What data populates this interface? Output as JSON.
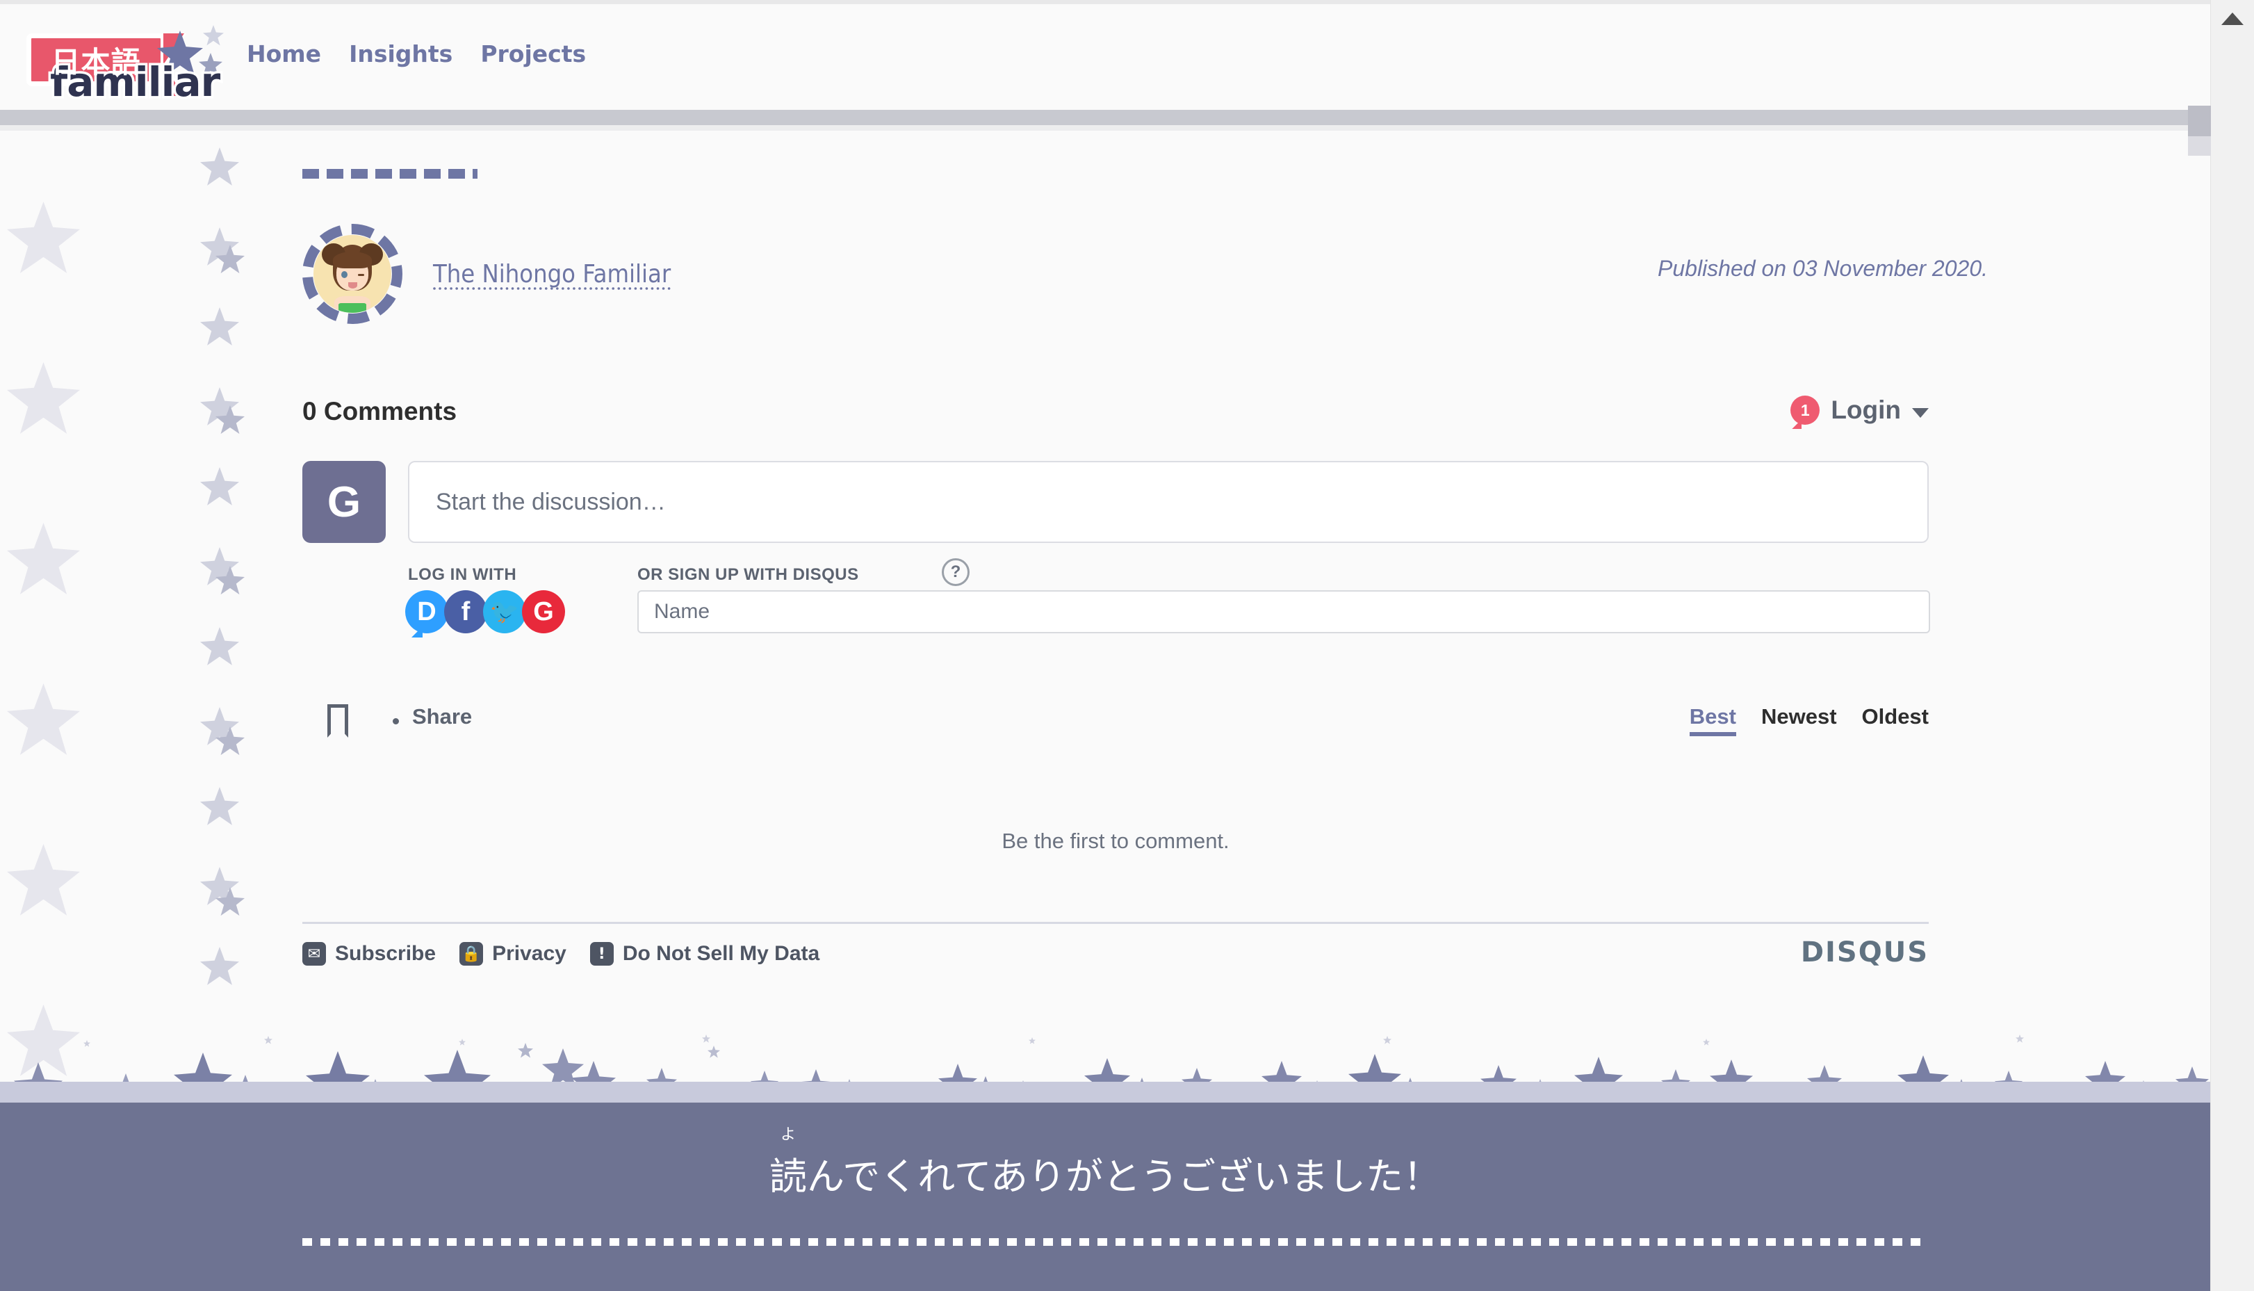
{
  "brand": {
    "logo_jp": "日本語",
    "logo_word": "familiar"
  },
  "nav": {
    "items": [
      {
        "label": "Home"
      },
      {
        "label": "Insights"
      },
      {
        "label": "Projects"
      }
    ]
  },
  "article": {
    "author_name": "The Nihongo Familiar",
    "published": "Published on 03 November 2020."
  },
  "disqus": {
    "comments_count": "0 Comments",
    "login_badge": "1",
    "login_label": "Login",
    "guest_initial": "G",
    "compose_placeholder": "Start the discussion…",
    "log_in_with_label": "LOG IN WITH",
    "sign_up_label": "OR SIGN UP WITH DISQUS",
    "help_glyph": "?",
    "social": [
      {
        "name": "disqus",
        "glyph": "D"
      },
      {
        "name": "facebook",
        "glyph": "f"
      },
      {
        "name": "twitter",
        "glyph": "🐦"
      },
      {
        "name": "google",
        "glyph": "G"
      }
    ],
    "name_placeholder": "Name",
    "share_label": "Share",
    "sorts": [
      {
        "label": "Best",
        "active": true
      },
      {
        "label": "Newest",
        "active": false
      },
      {
        "label": "Oldest",
        "active": false
      }
    ],
    "empty_note": "Be the first to comment.",
    "footer_links": [
      {
        "icon": "envelope-icon",
        "glyph": "✉",
        "label": "Subscribe"
      },
      {
        "icon": "lock-icon",
        "glyph": "🔒",
        "label": "Privacy"
      },
      {
        "icon": "exclamation-icon",
        "glyph": "!",
        "label": "Do Not Sell My Data"
      }
    ],
    "logo": "DISQUS"
  },
  "footer": {
    "ruby": "よ",
    "kanji": "読",
    "rest": "んでくれてありがとうございました！"
  },
  "colors": {
    "accent_purple": "#6e76a4",
    "brand_red": "#e8576b",
    "footer_bg": "#6e7392",
    "band_lavender": "#c8cadc"
  }
}
